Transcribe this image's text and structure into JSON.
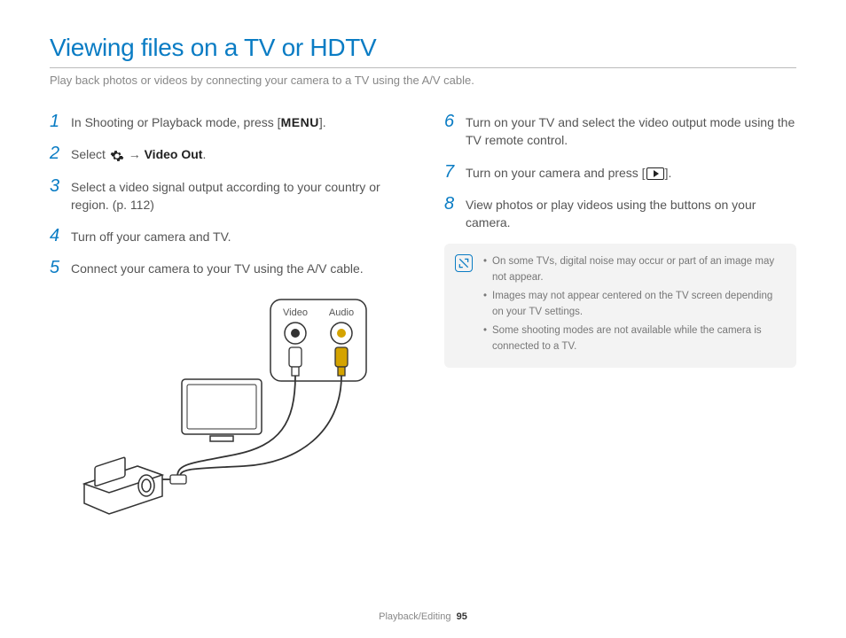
{
  "title": "Viewing files on a TV or HDTV",
  "subtitle": "Play back photos or videos by connecting your camera to a TV using the A/V cable.",
  "left": {
    "steps": {
      "1": {
        "num": "1",
        "pre": "In Shooting or Playback mode, press [",
        "btn": "MENU",
        "post": "]."
      },
      "2": {
        "num": "2",
        "pre": "Select ",
        "arrow": " → ",
        "bold": "Video Out",
        "post": "."
      },
      "3": {
        "num": "3",
        "text": "Select a video signal output according to your country or region. (p. 112)"
      },
      "4": {
        "num": "4",
        "text": "Turn off your camera and TV."
      },
      "5": {
        "num": "5",
        "text": "Connect your camera to your TV using the A/V cable."
      }
    },
    "diagram": {
      "video": "Video",
      "audio": "Audio"
    }
  },
  "right": {
    "steps": {
      "6": {
        "num": "6",
        "text": "Turn on your TV and select the video output mode using the TV remote control."
      },
      "7": {
        "num": "7",
        "pre": "Turn on your camera and press [",
        "post": "]."
      },
      "8": {
        "num": "8",
        "text": "View photos or play videos using the buttons on your camera."
      }
    },
    "notes": [
      "On some TVs, digital noise may occur or part of an image may not appear.",
      "Images may not appear centered on the TV screen depending on your TV settings.",
      "Some shooting modes are not available while the camera is connected to a TV."
    ]
  },
  "footer": {
    "section": "Playback/Editing",
    "page": "95"
  }
}
